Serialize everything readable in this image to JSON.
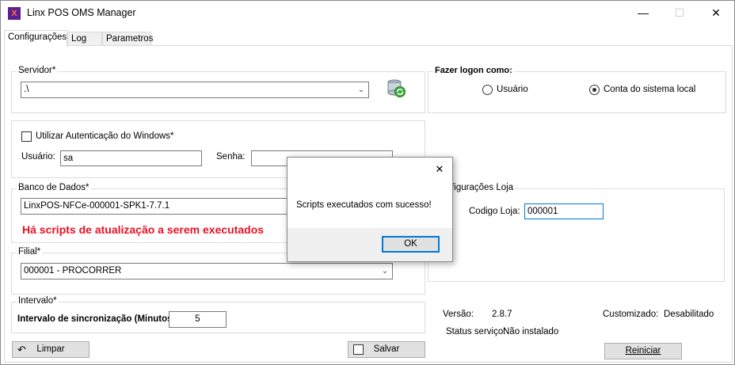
{
  "window": {
    "title": "Linx POS OMS Manager",
    "app_icon": "linx-logo-icon",
    "minimize": "—",
    "maximize": "☐",
    "close": "✕"
  },
  "tabs": [
    {
      "label": "Configurações",
      "active": true
    },
    {
      "label": "Log",
      "active": false
    },
    {
      "label": "Parametros",
      "active": false
    }
  ],
  "servidor": {
    "group_title": "Servidor*",
    "value": ".\\",
    "refresh_icon": "database-refresh-icon"
  },
  "auth": {
    "checkbox_label": "Utilizar Autenticação do Windows*",
    "checked": false,
    "usuario_label": "Usuário:",
    "usuario_value": "sa",
    "senha_label": "Senha:",
    "senha_value": ""
  },
  "banco": {
    "group_title": "Banco de Dados*",
    "value": "LinxPOS-NFCe-000001-SPK1-7.7.1",
    "warning": "Há scripts de atualização a serem executados",
    "warning_color": "#e81123"
  },
  "filial": {
    "group_title": "Filial*",
    "value": "000001 - PROCORRER"
  },
  "intervalo": {
    "group_title": "Intervalo*",
    "label": "Intervalo de sincronização (Minutos)",
    "value": "5"
  },
  "buttons": {
    "limpar": "Limpar",
    "salvar": "Salvar",
    "reiniciar": "Reiniciar"
  },
  "logon": {
    "group_title": "Fazer logon como:",
    "options": [
      {
        "label": "Usuário",
        "selected": false
      },
      {
        "label": "Conta do sistema local",
        "selected": true
      }
    ]
  },
  "loja": {
    "group_title": "Configurações Loja",
    "codigo_label": "Codigo Loja:",
    "codigo_value": "000001"
  },
  "info": {
    "versao_label": "Versão:",
    "versao_value": "2.8.7",
    "customizado_label": "Customizado:",
    "customizado_value": "Desabilitado",
    "status_label": "Status serviço:",
    "status_value": "Não instalado"
  },
  "dialog": {
    "message": "Scripts executados com sucesso!",
    "ok": "OK",
    "close": "✕"
  }
}
